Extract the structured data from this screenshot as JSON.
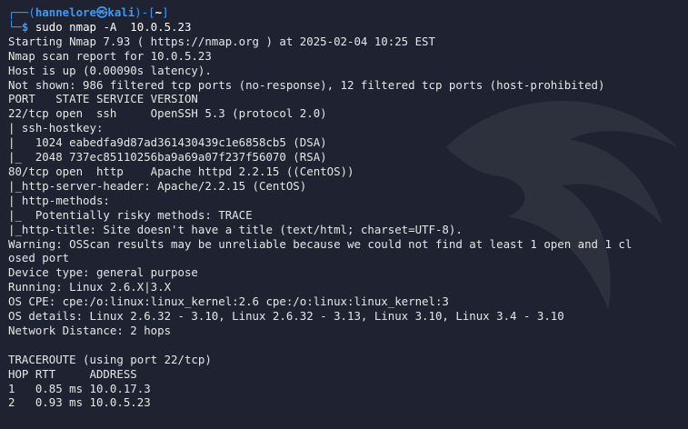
{
  "prompt": {
    "corner_top": "┌──(",
    "user": "hannelore",
    "at": "㉿",
    "host": "kali",
    "sep": ")-[",
    "dir": "~",
    "close": "]",
    "corner_bottom": "└─",
    "dollar": "$",
    "command": " sudo nmap -A  10.0.5.23"
  },
  "output": [
    "Starting Nmap 7.93 ( https://nmap.org ) at 2025-02-04 10:25 EST",
    "Nmap scan report for 10.0.5.23",
    "Host is up (0.00090s latency).",
    "Not shown: 986 filtered tcp ports (no-response), 12 filtered tcp ports (host-prohibited)",
    "PORT   STATE SERVICE VERSION",
    "22/tcp open  ssh     OpenSSH 5.3 (protocol 2.0)",
    "| ssh-hostkey: ",
    "|   1024 eabedfa9d87ad361430439c1e6858cb5 (DSA)",
    "|_  2048 737ec85110256ba9a69a07f237f56070 (RSA)",
    "80/tcp open  http    Apache httpd 2.2.15 ((CentOS))",
    "|_http-server-header: Apache/2.2.15 (CentOS)",
    "| http-methods: ",
    "|_  Potentially risky methods: TRACE",
    "|_http-title: Site doesn't have a title (text/html; charset=UTF-8).",
    "Warning: OSScan results may be unreliable because we could not find at least 1 open and 1 cl",
    "osed port",
    "Device type: general purpose",
    "Running: Linux 2.6.X|3.X",
    "OS CPE: cpe:/o:linux:linux_kernel:2.6 cpe:/o:linux:linux_kernel:3",
    "OS details: Linux 2.6.32 - 3.10, Linux 2.6.32 - 3.13, Linux 3.10, Linux 3.4 - 3.10",
    "Network Distance: 2 hops",
    "",
    "TRACEROUTE (using port 22/tcp)",
    "HOP RTT     ADDRESS",
    "1   0.85 ms 10.0.17.3",
    "2   0.93 ms 10.0.5.23"
  ]
}
